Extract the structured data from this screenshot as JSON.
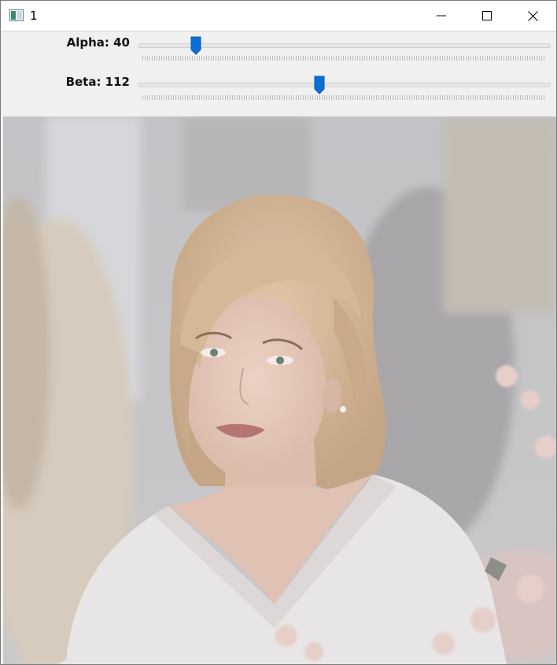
{
  "window": {
    "title": "1",
    "app_icon": "app-window-icon",
    "buttons": {
      "minimize_icon": "minimize-icon",
      "maximize_icon": "maximize-icon",
      "close_icon": "close-icon"
    }
  },
  "trackbars": [
    {
      "label": "Alpha: 40",
      "value": 40,
      "thumb_fraction": 0.14
    },
    {
      "label": "Beta: 112",
      "value": 112,
      "thumb_fraction": 0.44
    }
  ],
  "image": {
    "description_name": "portrait-photo",
    "accent": "#0a6fd6"
  }
}
